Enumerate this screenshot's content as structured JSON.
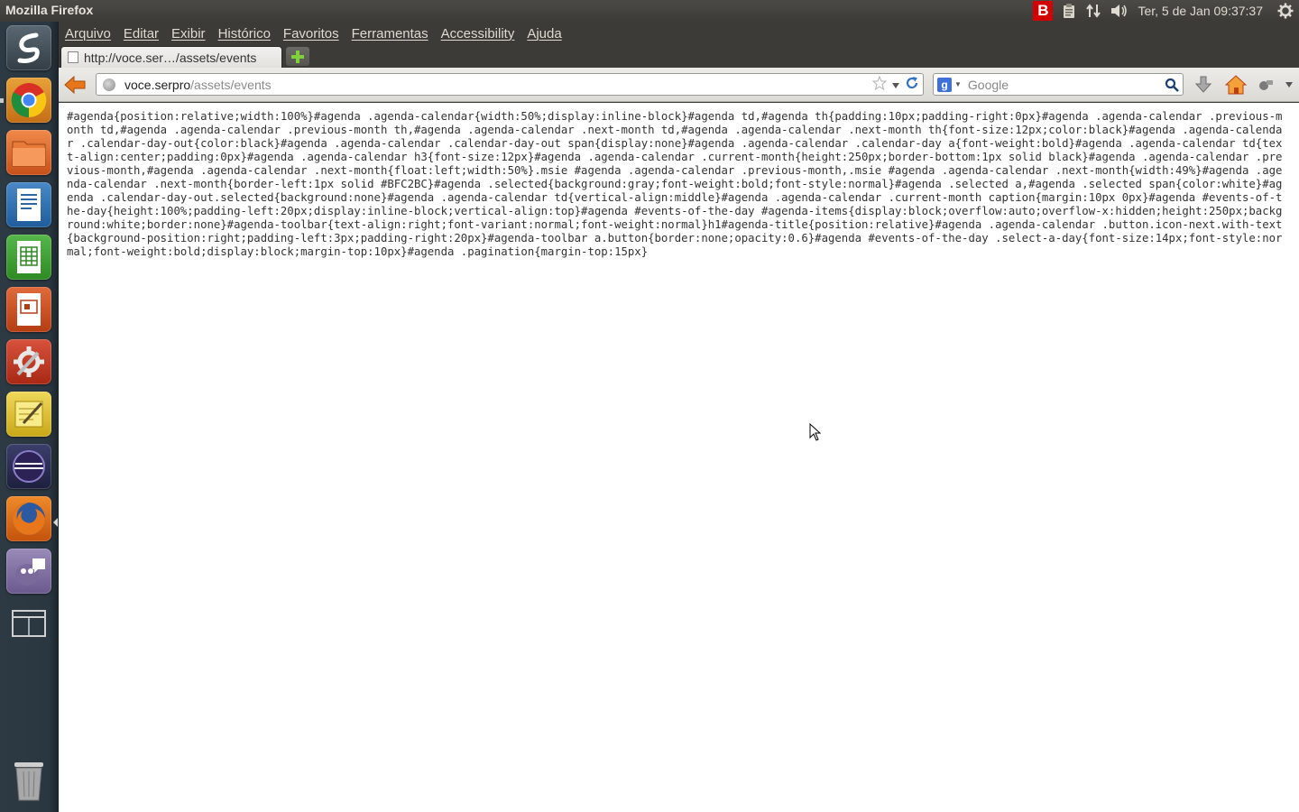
{
  "top_panel": {
    "window_title": "Mozilla Firefox",
    "indicator_b": "B",
    "clock": "Ter,  5 de Jan 09:37:37"
  },
  "launcher": {
    "items": [
      "dash-home",
      "chromium",
      "file-manager",
      "writer",
      "calc",
      "impress",
      "system-settings",
      "text-editor",
      "eclipse",
      "firefox",
      "pidgin",
      "workspace-switcher",
      "trash"
    ]
  },
  "menubar": {
    "items": [
      "Arquivo",
      "Editar",
      "Exibir",
      "Histórico",
      "Favoritos",
      "Ferramentas",
      "Accessibility",
      "Ajuda"
    ]
  },
  "tabs": [
    {
      "title": "http://voce.ser…/assets/events"
    }
  ],
  "navbar": {
    "url_host": "voce.serpro",
    "url_path": "/assets/events",
    "search_placeholder": "Google",
    "search_engine": "g"
  },
  "content": {
    "css_text": "#agenda{position:relative;width:100%}#agenda .agenda-calendar{width:50%;display:inline-block}#agenda td,#agenda th{padding:10px;padding-right:0px}#agenda .agenda-calendar .previous-month td,#agenda .agenda-calendar .previous-month th,#agenda .agenda-calendar .next-month td,#agenda .agenda-calendar .next-month th{font-size:12px;color:black}#agenda .agenda-calendar .calendar-day-out{color:black}#agenda .agenda-calendar .calendar-day-out span{display:none}#agenda .agenda-calendar .calendar-day a{font-weight:bold}#agenda .agenda-calendar td{text-align:center;padding:0px}#agenda .agenda-calendar h3{font-size:12px}#agenda .agenda-calendar .current-month{height:250px;border-bottom:1px solid black}#agenda .agenda-calendar .previous-month,#agenda .agenda-calendar .next-month{float:left;width:50%}.msie #agenda .agenda-calendar .previous-month,.msie #agenda .agenda-calendar .next-month{width:49%}#agenda .agenda-calendar .next-month{border-left:1px solid #BFC2BC}#agenda .selected{background:gray;font-weight:bold;font-style:normal}#agenda .selected a,#agenda .selected span{color:white}#agenda .calendar-day-out.selected{background:none}#agenda .agenda-calendar td{vertical-align:middle}#agenda .agenda-calendar .current-month caption{margin:10px 0px}#agenda #events-of-the-day{height:100%;padding-left:20px;display:inline-block;vertical-align:top}#agenda #events-of-the-day #agenda-items{display:block;overflow:auto;overflow-x:hidden;height:250px;background:white;border:none}#agenda-toolbar{text-align:right;font-variant:normal;font-weight:normal}h1#agenda-title{position:relative}#agenda .agenda-calendar .button.icon-next.with-text{background-position:right;padding-left:3px;padding-right:20px}#agenda-toolbar a.button{border:none;opacity:0.6}#agenda #events-of-the-day .select-a-day{font-size:14px;font-style:normal;font-weight:bold;display:block;margin-top:10px}#agenda .pagination{margin-top:15px}"
  },
  "colors": {
    "panel": "#3c3b37",
    "launcher": "#2d3a44",
    "content_bg": "#ffffff",
    "b_indicator": "#d20000"
  }
}
